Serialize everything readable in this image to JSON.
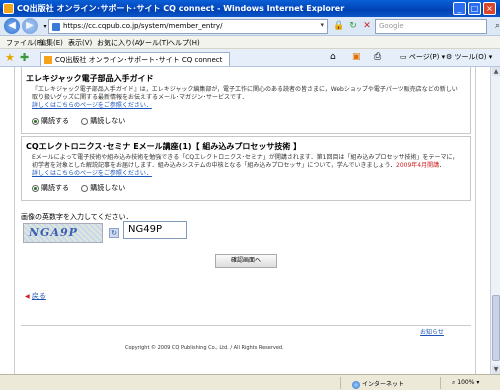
{
  "window": {
    "title": "CQ出版社 オンライン･サポート･サイト CQ connect - Windows Internet Explorer"
  },
  "addressbar": {
    "url": "https://cc.cqpub.co.jp/system/member_entry/",
    "search_placeholder": "Google"
  },
  "menu": [
    "ファイル(F)",
    "編集(E)",
    "表示(V)",
    "お気に入り(A)",
    "ツール(T)",
    "ヘルプ(H)"
  ],
  "tab": {
    "label": "CQ出版社 オンライン･サポート･サイト CQ connect"
  },
  "toolbar": {
    "page_label": "ページ(P)",
    "tools_label": "ツール(O)"
  },
  "section1": {
    "title": "エレキジャック電子部品入手ガイド",
    "desc": "『エレキジャック電子部品入手ガイド』は，エレキジャック編集部が，電子工作に関心のある読者の皆さまに，Webショップや電子パーツ販売店などの新しい取り扱いグッズに関する最新情報をお伝えするメール･マガジン･サービスです．",
    "link": "詳しくはこちらのページをご参照ください．",
    "opt_yes": "購読する",
    "opt_no": "購読しない"
  },
  "section2": {
    "title": "CQエレクトロニクス･セミナ Eメール講座(1)【 組み込みプロセッサ技術 】",
    "desc": "Eメールによって電子技術や組み込み技術を勉強できる「CQエレクトロニクス･セミナ」が開講されます．第1回目は「組み込みプロセッサ技術」をテーマに，初学者を対象とした解説記事をお届けします．組み込みシステムの中核となる「組み込みプロセッサ」について，学んでいきましょう．2009年4月開講．",
    "desc_highlight": "2009年4月開講",
    "link": "詳しくはこちらのページをご参照ください．",
    "opt_yes": "購読する",
    "opt_no": "購読しない"
  },
  "captcha": {
    "label": "画像の英数字を入力してください．",
    "image_text": "NGA9P",
    "input_value": "NG49P"
  },
  "confirm_button": "確認画面へ",
  "back_link": "戻る",
  "notice_link": "お知らせ",
  "copyright": "Copyright © 2009 CQ Publishing Co., Ltd. / All Rights Reserved.",
  "status": {
    "zone": "インターネット",
    "zoom": "100%"
  }
}
